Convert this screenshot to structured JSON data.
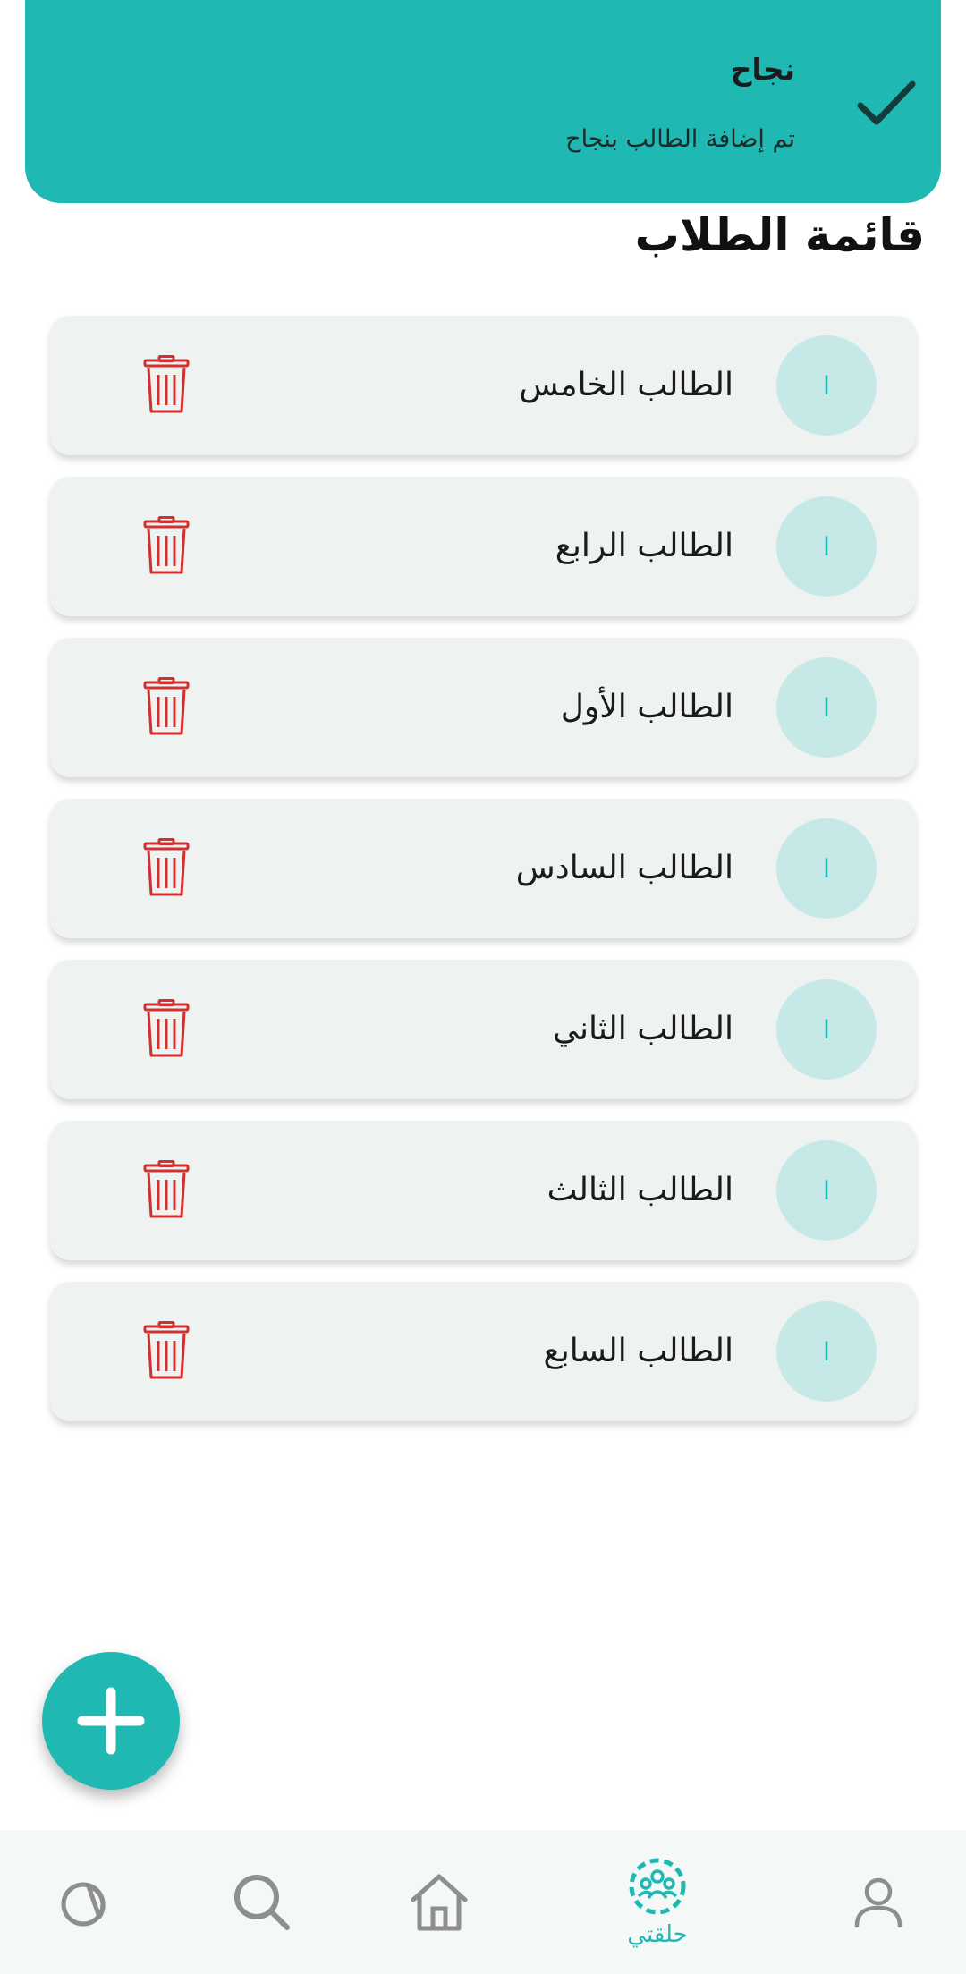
{
  "toast": {
    "title": "نجاح",
    "message": "تم إضافة الطالب بنجاح",
    "icon": "check-icon",
    "color": "#20b8b3"
  },
  "page_title": "قائمة الطلاب",
  "students": [
    {
      "name": "الطالب الخامس",
      "avatar_text": "ا"
    },
    {
      "name": "الطالب الرابع",
      "avatar_text": "ا"
    },
    {
      "name": "الطالب الأول",
      "avatar_text": "ا"
    },
    {
      "name": "الطالب السادس",
      "avatar_text": "ا"
    },
    {
      "name": "الطالب الثاني",
      "avatar_text": "ا"
    },
    {
      "name": "الطالب الثالث",
      "avatar_text": "ا"
    },
    {
      "name": "الطالب السابع",
      "avatar_text": "ا"
    }
  ],
  "student_card": {
    "delete_icon": "trash-icon",
    "delete_color": "#d32f2f"
  },
  "fab": {
    "icon": "plus-icon",
    "color": "#20b8b3"
  },
  "bottom_nav": {
    "items": [
      {
        "icon": "profile-icon",
        "label": ""
      },
      {
        "icon": "group-icon",
        "label": "حلقتي",
        "active": true
      },
      {
        "icon": "home-icon",
        "label": ""
      },
      {
        "icon": "search-icon",
        "label": ""
      },
      {
        "icon": "pie-chart-icon",
        "label": ""
      }
    ],
    "active_color": "#20b8b3",
    "inactive_color": "#8e8e8e"
  }
}
